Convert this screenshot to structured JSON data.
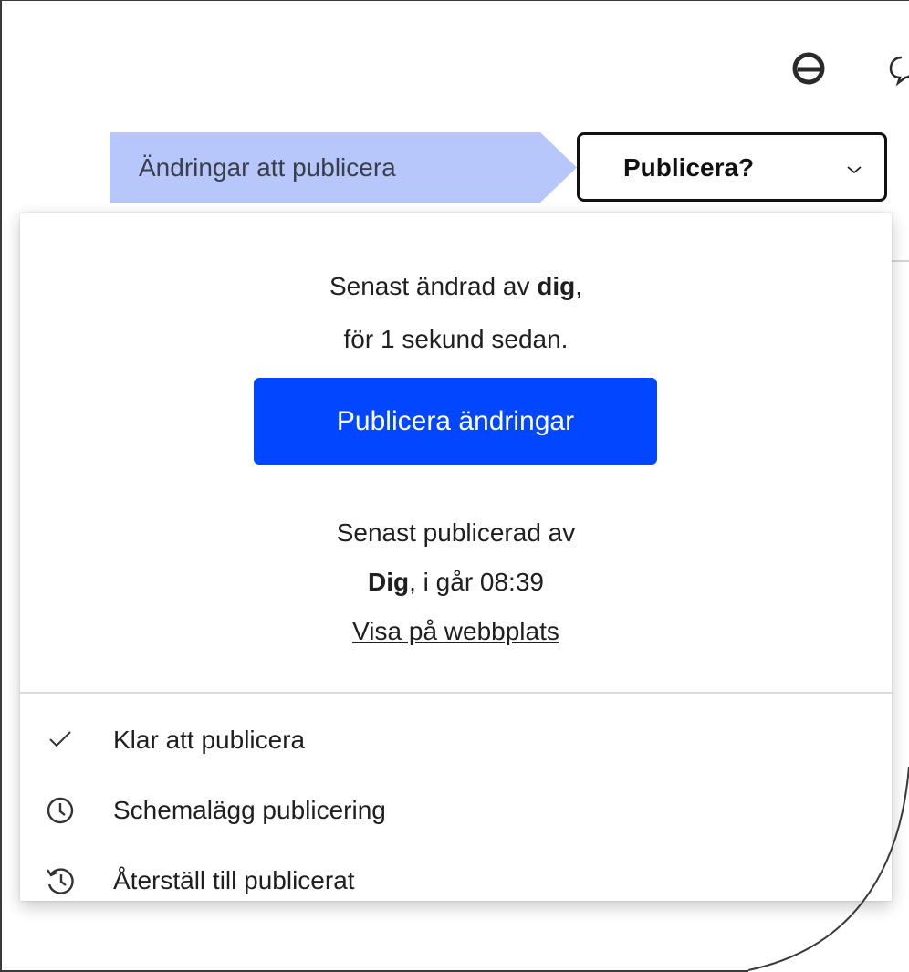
{
  "toolbar": {
    "icons": [
      "loading-icon",
      "chat-icon"
    ]
  },
  "status": {
    "label": "Ändringar att publicera"
  },
  "publish_dropdown": {
    "label": "Publicera?",
    "icon": "chevron-down-icon"
  },
  "popover": {
    "last_changed": {
      "prefix": "Senast ändrad av ",
      "user": "dig",
      "suffix": ",",
      "time": "för 1 sekund sedan."
    },
    "publish_button": "Publicera ändringar",
    "last_published": {
      "line1": "Senast publicerad av",
      "user": "Dig",
      "time": ", i går 08:39"
    },
    "view_link": "Visa på webbplats",
    "menu": [
      {
        "label": "Klar att publicera",
        "icon": "check-icon"
      },
      {
        "label": "Schemalägg publicering",
        "icon": "clock-icon"
      },
      {
        "label": "Återställ till publicerat",
        "icon": "history-icon"
      }
    ]
  },
  "colors": {
    "primary": "#0047ff",
    "status_chip": "#b7c7fb"
  }
}
